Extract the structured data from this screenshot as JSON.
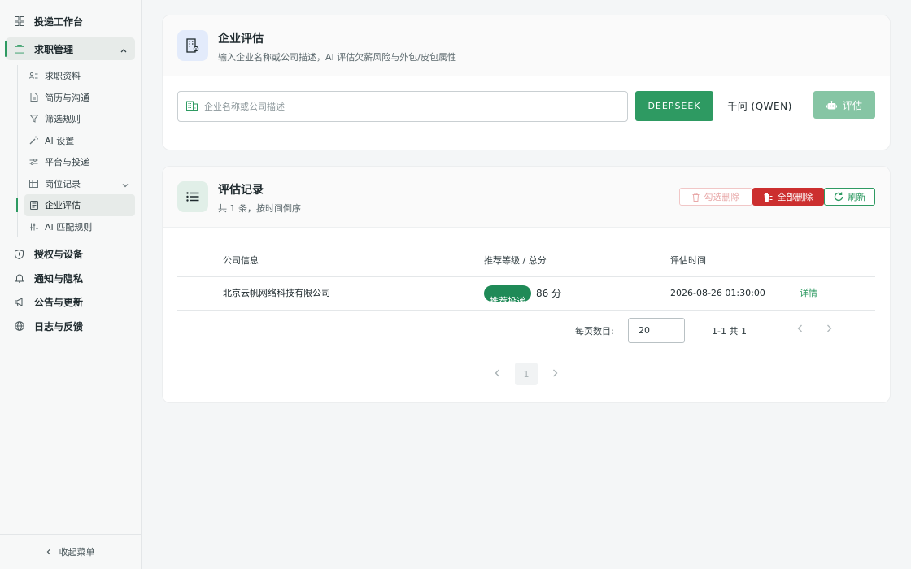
{
  "sidebar": {
    "top_item": "投递工作台",
    "group": "求职管理",
    "sub_items": [
      "求职资料",
      "简历与沟通",
      "筛选规则",
      "AI 设置",
      "平台与投递",
      "岗位记录",
      "企业评估",
      "AI 匹配规则"
    ],
    "main_items": [
      "授权与设备",
      "通知与隐私",
      "公告与更新",
      "日志与反馈"
    ],
    "collapse": "收起菜单"
  },
  "evaluate": {
    "title": "企业评估",
    "subtitle": "输入企业名称或公司描述，AI 评估欠薪风险与外包/皮包属性",
    "placeholder": "企业名称或公司描述",
    "deepseek": "DEEPSEEK",
    "qwen": "千问 (QWEN)",
    "evaluate_btn": "评估"
  },
  "records": {
    "title": "评估记录",
    "subtitle": "共 1 条，按时间倒序",
    "btn_select_delete": "勾选删除",
    "btn_delete_all": "全部删除",
    "btn_refresh": "刷新",
    "columns": [
      "公司信息",
      "推荐等级 / 总分",
      "评估时间"
    ],
    "rows": [
      {
        "company": "北京云帆网络科技有限公司",
        "level": "推荐投递",
        "score": "86 分",
        "time": "2026-08-26 01:30:00",
        "action": "详情"
      }
    ],
    "per_page_label": "每页数目:",
    "per_page_value": "20",
    "range": "1-1 共 1",
    "page": "1"
  },
  "colors": {
    "accent": "#2e9a62",
    "danger": "#cc2f2f",
    "badge": "#1f8a57"
  }
}
